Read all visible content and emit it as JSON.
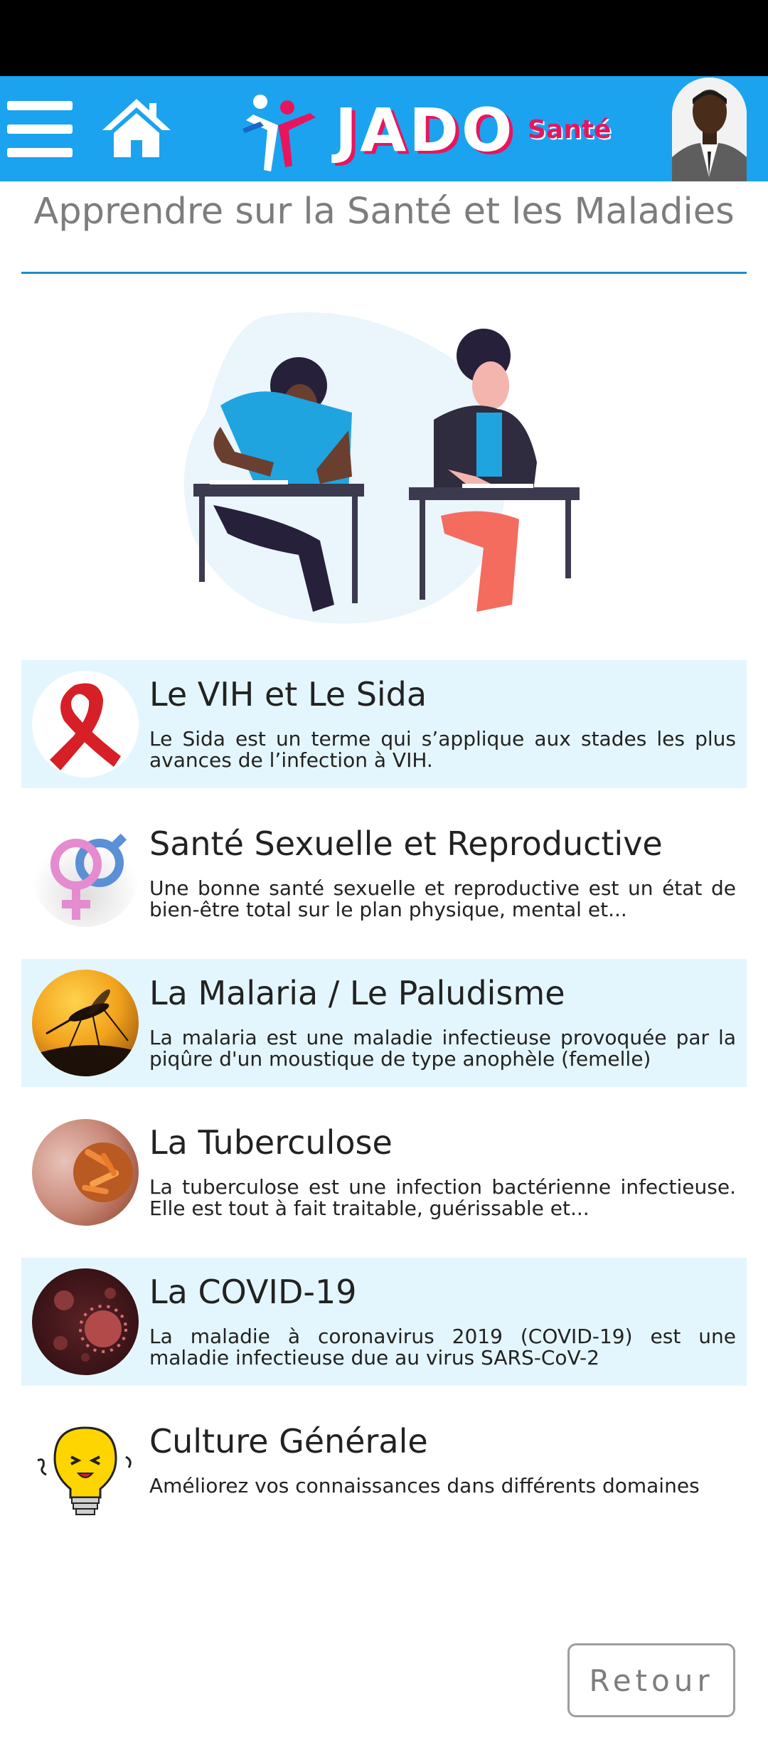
{
  "app": {
    "logo_name": "JADO",
    "logo_sub": "Santé"
  },
  "page": {
    "title": "Apprendre sur la Santé et les Maladies"
  },
  "topics": [
    {
      "title": "Le VIH et Le Sida",
      "description": "Le Sida est un terme qui s’applique aux stades les plus avances de l’infection à VIH.",
      "icon": "red-ribbon-icon"
    },
    {
      "title": "Santé Sexuelle et Reproductive",
      "description": "Une bonne santé sexuelle et reproductive est un état de bien-être total sur le plan physique, mental et...",
      "icon": "gender-symbols-icon"
    },
    {
      "title": "La Malaria / Le Paludisme",
      "description": "La malaria est une maladie infectieuse provoquée par la piqûre d'un moustique de type anophèle (femelle)",
      "icon": "mosquito-icon"
    },
    {
      "title": "La Tuberculose",
      "description": "La tuberculose est une infection bactérienne infectieuse. Elle est tout à fait traitable, guérissable et...",
      "icon": "bacteria-lungs-icon"
    },
    {
      "title": "La COVID-19",
      "description": "La maladie à coronavirus 2019 (COVID-19) est une maladie infectieuse due au virus SARS-CoV-2",
      "icon": "coronavirus-icon"
    },
    {
      "title": "Culture Générale",
      "description": "Améliorez vos connaissances dans différents domaines",
      "icon": "lightbulb-icon"
    }
  ],
  "footer": {
    "back_label": "Retour"
  },
  "colors": {
    "app_bar": "#1ba3ef",
    "accent_pink": "#e8155e",
    "card_shade": "#e4f6fd"
  }
}
